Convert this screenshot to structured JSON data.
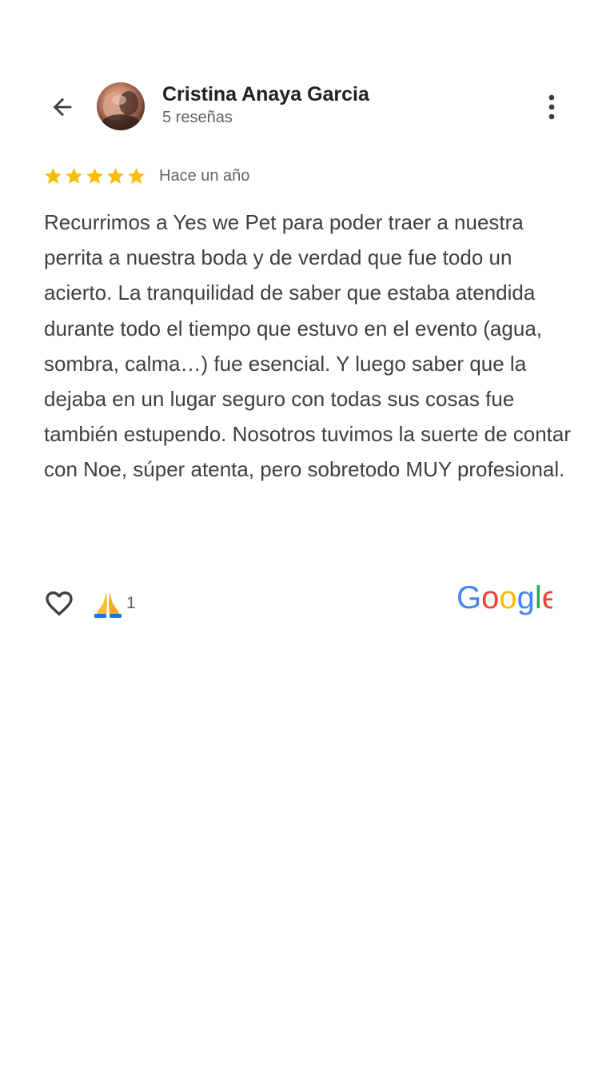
{
  "header": {
    "reviewer_name": "Cristina Anaya Garcia",
    "review_count": "5 reseñas"
  },
  "review": {
    "rating": 5,
    "max_rating": 5,
    "date": "Hace un año",
    "text": "Recurrimos a Yes we Pet para poder traer a nuestra perrita a nuestra boda y de verdad que fue todo un acierto. La tranquilidad de saber que estaba atendida durante todo el tiempo que estuvo en el evento (agua, sombra, calma…) fue esencial. Y luego saber que la dejaba en un lugar seguro con todas sus cosas fue también estupendo. Nosotros tuvimos la suerte de contar con Noe, súper atenta, pero sobretodo MUY profesional."
  },
  "reactions": {
    "emoji": "🙏",
    "count": "1"
  },
  "branding": {
    "logo_text": "Google",
    "logo_colors": [
      "#4285F4",
      "#EA4335",
      "#FBBC05",
      "#4285F4",
      "#34A853",
      "#EA4335"
    ]
  },
  "colors": {
    "star": "#FBBC04",
    "text_primary": "#202124",
    "text_secondary": "#5f6368"
  },
  "icons": {
    "back": "arrow-left-icon",
    "more": "more-vert-icon",
    "like": "heart-outline-icon",
    "star": "star-icon",
    "reaction": "folded-hands-icon"
  }
}
